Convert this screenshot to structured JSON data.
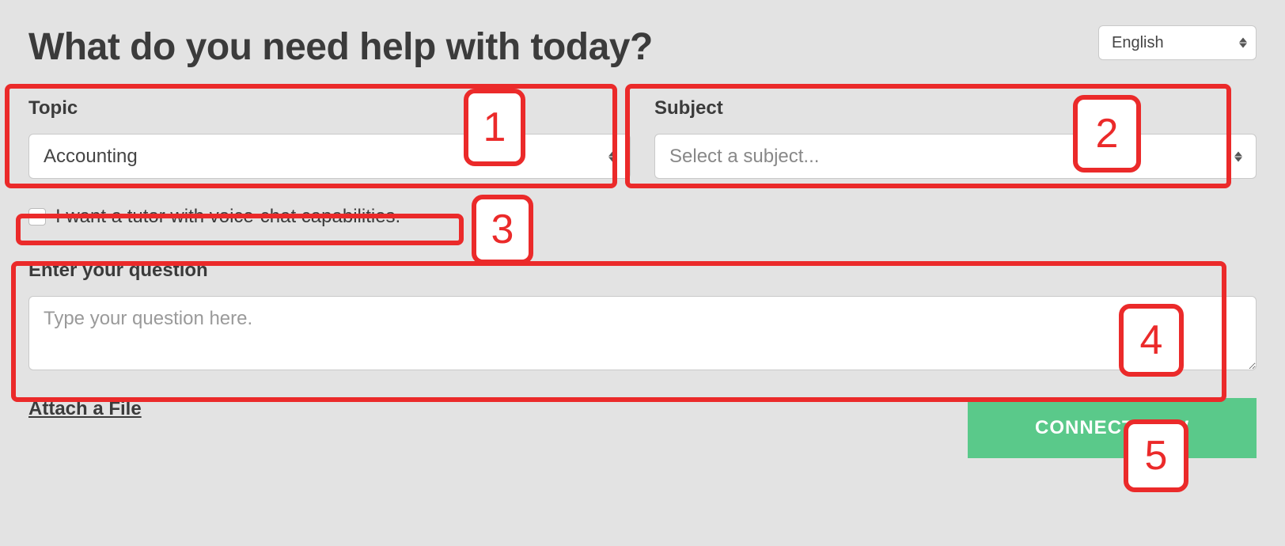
{
  "header": {
    "title": "What do you need help with today?"
  },
  "language": {
    "selected": "English"
  },
  "topic": {
    "label": "Topic",
    "selected": "Accounting"
  },
  "subject": {
    "label": "Subject",
    "placeholder": "Select a subject..."
  },
  "voice_chat": {
    "label": "I want a tutor with voice-chat capabilities."
  },
  "question": {
    "label": "Enter your question",
    "placeholder": "Type your question here."
  },
  "attach": {
    "label": "Attach a File"
  },
  "connect": {
    "label": "CONNECT NOW"
  },
  "annotations": {
    "n1": "1",
    "n2": "2",
    "n3": "3",
    "n4": "4",
    "n5": "5"
  }
}
